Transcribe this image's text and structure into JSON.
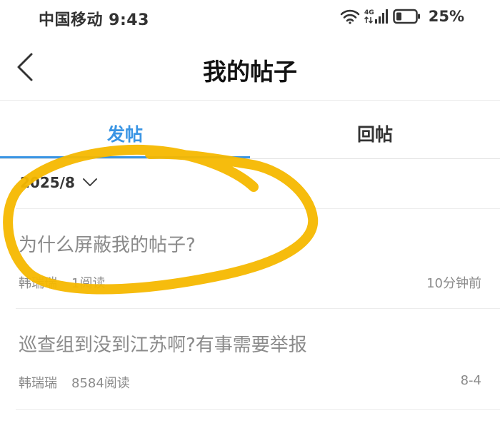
{
  "status_bar": {
    "carrier_time": "中国移动 9:43",
    "network_type": "4G",
    "battery_percent": "25%",
    "icons": [
      "wifi-icon",
      "signal-icon",
      "battery-icon"
    ]
  },
  "header": {
    "title": "我的帖子",
    "back_icon": "back-chevron-icon"
  },
  "tabs": [
    {
      "label": "发帖",
      "active": true
    },
    {
      "label": "回帖",
      "active": false
    }
  ],
  "filter": {
    "date": "2025/8",
    "icon": "chevron-down-icon"
  },
  "posts": [
    {
      "title": "为什么屏蔽我的帖子?",
      "author": "韩瑞瑞",
      "reads": "1阅读",
      "time": "10分钟前"
    },
    {
      "title": "巡查组到没到江苏啊?有事需要举报",
      "author": "韩瑞瑞",
      "reads": "8584阅读",
      "time": "8-4"
    }
  ],
  "colors": {
    "accent": "#3a95e4",
    "muted_text": "#8a8a8a",
    "annotation": "#f6b800"
  }
}
